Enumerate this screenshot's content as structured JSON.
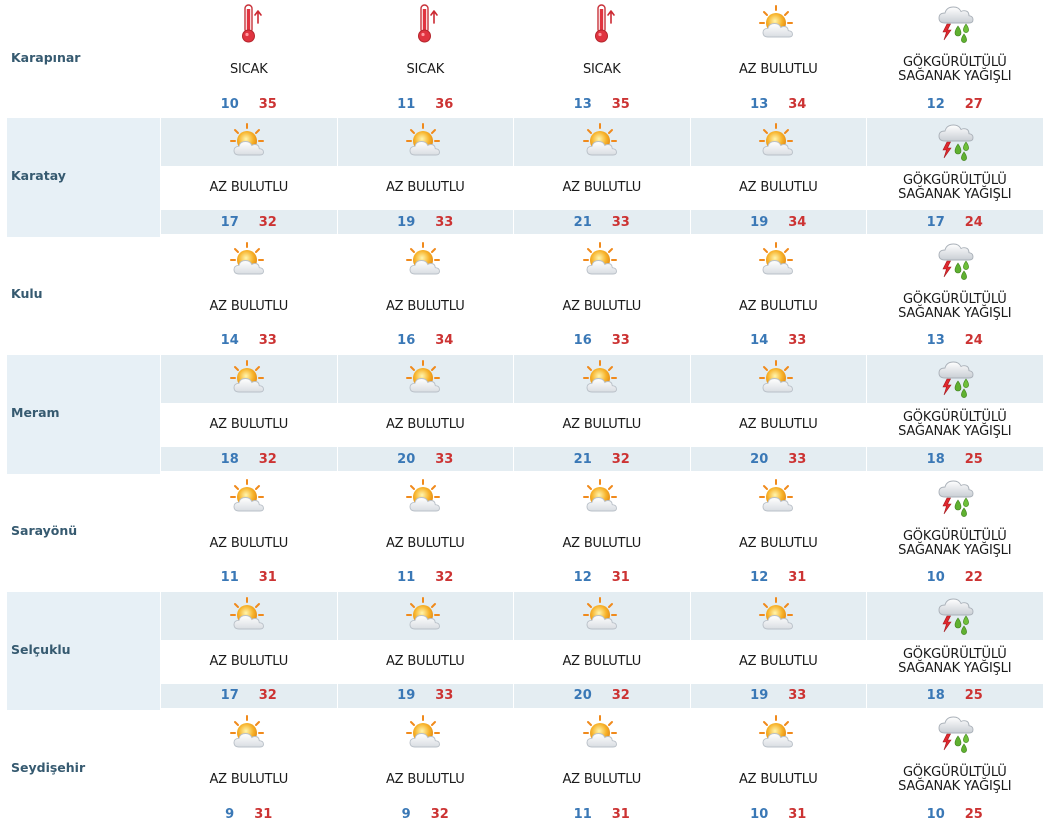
{
  "rows": [
    {
      "district": "Karapınar",
      "days": [
        {
          "icon": "thermometer-hot-icon",
          "desc": "SICAK",
          "min": "10",
          "max": "35"
        },
        {
          "icon": "thermometer-hot-icon",
          "desc": "SICAK",
          "min": "11",
          "max": "36"
        },
        {
          "icon": "thermometer-hot-icon",
          "desc": "SICAK",
          "min": "13",
          "max": "35"
        },
        {
          "icon": "partly-cloudy-icon",
          "desc": "AZ BULUTLU",
          "min": "13",
          "max": "34"
        },
        {
          "icon": "thunder-shower-icon",
          "desc": "GÖKGÜRÜLTÜLÜ\nSAĞANAK YAĞIŞLI",
          "min": "12",
          "max": "27"
        }
      ]
    },
    {
      "district": "Karatay",
      "days": [
        {
          "icon": "partly-cloudy-icon",
          "desc": "AZ BULUTLU",
          "min": "17",
          "max": "32"
        },
        {
          "icon": "partly-cloudy-icon",
          "desc": "AZ BULUTLU",
          "min": "19",
          "max": "33"
        },
        {
          "icon": "partly-cloudy-icon",
          "desc": "AZ BULUTLU",
          "min": "21",
          "max": "33"
        },
        {
          "icon": "partly-cloudy-icon",
          "desc": "AZ BULUTLU",
          "min": "19",
          "max": "34"
        },
        {
          "icon": "thunder-shower-icon",
          "desc": "GÖKGÜRÜLTÜLÜ\nSAĞANAK YAĞIŞLI",
          "min": "17",
          "max": "24"
        }
      ]
    },
    {
      "district": "Kulu",
      "days": [
        {
          "icon": "partly-cloudy-icon",
          "desc": "AZ BULUTLU",
          "min": "14",
          "max": "33"
        },
        {
          "icon": "partly-cloudy-icon",
          "desc": "AZ BULUTLU",
          "min": "16",
          "max": "34"
        },
        {
          "icon": "partly-cloudy-icon",
          "desc": "AZ BULUTLU",
          "min": "16",
          "max": "33"
        },
        {
          "icon": "partly-cloudy-icon",
          "desc": "AZ BULUTLU",
          "min": "14",
          "max": "33"
        },
        {
          "icon": "thunder-shower-icon",
          "desc": "GÖKGÜRÜLTÜLÜ\nSAĞANAK YAĞIŞLI",
          "min": "13",
          "max": "24"
        }
      ]
    },
    {
      "district": "Meram",
      "days": [
        {
          "icon": "partly-cloudy-icon",
          "desc": "AZ BULUTLU",
          "min": "18",
          "max": "32"
        },
        {
          "icon": "partly-cloudy-icon",
          "desc": "AZ BULUTLU",
          "min": "20",
          "max": "33"
        },
        {
          "icon": "partly-cloudy-icon",
          "desc": "AZ BULUTLU",
          "min": "21",
          "max": "32"
        },
        {
          "icon": "partly-cloudy-icon",
          "desc": "AZ BULUTLU",
          "min": "20",
          "max": "33"
        },
        {
          "icon": "thunder-shower-icon",
          "desc": "GÖKGÜRÜLTÜLÜ\nSAĞANAK YAĞIŞLI",
          "min": "18",
          "max": "25"
        }
      ]
    },
    {
      "district": "Sarayönü",
      "days": [
        {
          "icon": "partly-cloudy-icon",
          "desc": "AZ BULUTLU",
          "min": "11",
          "max": "31"
        },
        {
          "icon": "partly-cloudy-icon",
          "desc": "AZ BULUTLU",
          "min": "11",
          "max": "32"
        },
        {
          "icon": "partly-cloudy-icon",
          "desc": "AZ BULUTLU",
          "min": "12",
          "max": "31"
        },
        {
          "icon": "partly-cloudy-icon",
          "desc": "AZ BULUTLU",
          "min": "12",
          "max": "31"
        },
        {
          "icon": "thunder-shower-icon",
          "desc": "GÖKGÜRÜLTÜLÜ\nSAĞANAK YAĞIŞLI",
          "min": "10",
          "max": "22"
        }
      ]
    },
    {
      "district": "Selçuklu",
      "days": [
        {
          "icon": "partly-cloudy-icon",
          "desc": "AZ BULUTLU",
          "min": "17",
          "max": "32"
        },
        {
          "icon": "partly-cloudy-icon",
          "desc": "AZ BULUTLU",
          "min": "19",
          "max": "33"
        },
        {
          "icon": "partly-cloudy-icon",
          "desc": "AZ BULUTLU",
          "min": "20",
          "max": "32"
        },
        {
          "icon": "partly-cloudy-icon",
          "desc": "AZ BULUTLU",
          "min": "19",
          "max": "33"
        },
        {
          "icon": "thunder-shower-icon",
          "desc": "GÖKGÜRÜLTÜLÜ\nSAĞANAK YAĞIŞLI",
          "min": "18",
          "max": "25"
        }
      ]
    },
    {
      "district": "Seydişehir",
      "days": [
        {
          "icon": "partly-cloudy-icon",
          "desc": "AZ BULUTLU",
          "min": "9",
          "max": "31"
        },
        {
          "icon": "partly-cloudy-icon",
          "desc": "AZ BULUTLU",
          "min": "9",
          "max": "32"
        },
        {
          "icon": "partly-cloudy-icon",
          "desc": "AZ BULUTLU",
          "min": "11",
          "max": "31"
        },
        {
          "icon": "partly-cloudy-icon",
          "desc": "AZ BULUTLU",
          "min": "10",
          "max": "31"
        },
        {
          "icon": "thunder-shower-icon",
          "desc": "GÖKGÜRÜLTÜLÜ\nSAĞANAK YAĞIŞLI",
          "min": "10",
          "max": "25"
        }
      ]
    }
  ],
  "colors": {
    "min_temp": "#3a78b6",
    "max_temp": "#cc3333",
    "district_name": "#365a70",
    "row_shade": "#e7f0f6"
  }
}
